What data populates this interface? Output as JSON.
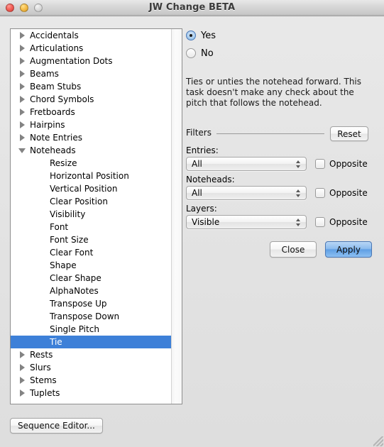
{
  "window": {
    "title": "JW Change BETA",
    "traffic_lights": [
      "close-button",
      "minimize-button",
      "zoom-button"
    ]
  },
  "tree": {
    "items": [
      {
        "label": "Accidentals",
        "level": 1,
        "state": "collapsed",
        "selected": false
      },
      {
        "label": "Articulations",
        "level": 1,
        "state": "collapsed",
        "selected": false
      },
      {
        "label": "Augmentation Dots",
        "level": 1,
        "state": "collapsed",
        "selected": false
      },
      {
        "label": "Beams",
        "level": 1,
        "state": "collapsed",
        "selected": false
      },
      {
        "label": "Beam Stubs",
        "level": 1,
        "state": "collapsed",
        "selected": false
      },
      {
        "label": "Chord Symbols",
        "level": 1,
        "state": "collapsed",
        "selected": false
      },
      {
        "label": "Fretboards",
        "level": 1,
        "state": "collapsed",
        "selected": false
      },
      {
        "label": "Hairpins",
        "level": 1,
        "state": "collapsed",
        "selected": false
      },
      {
        "label": "Note Entries",
        "level": 1,
        "state": "collapsed",
        "selected": false
      },
      {
        "label": "Noteheads",
        "level": 1,
        "state": "expanded",
        "selected": false
      },
      {
        "label": "Resize",
        "level": 2,
        "state": "leaf",
        "selected": false
      },
      {
        "label": "Horizontal Position",
        "level": 2,
        "state": "leaf",
        "selected": false
      },
      {
        "label": "Vertical Position",
        "level": 2,
        "state": "leaf",
        "selected": false
      },
      {
        "label": "Clear Position",
        "level": 2,
        "state": "leaf",
        "selected": false
      },
      {
        "label": "Visibility",
        "level": 2,
        "state": "leaf",
        "selected": false
      },
      {
        "label": "Font",
        "level": 2,
        "state": "leaf",
        "selected": false
      },
      {
        "label": "Font Size",
        "level": 2,
        "state": "leaf",
        "selected": false
      },
      {
        "label": "Clear Font",
        "level": 2,
        "state": "leaf",
        "selected": false
      },
      {
        "label": "Shape",
        "level": 2,
        "state": "leaf",
        "selected": false
      },
      {
        "label": "Clear Shape",
        "level": 2,
        "state": "leaf",
        "selected": false
      },
      {
        "label": "AlphaNotes",
        "level": 2,
        "state": "leaf",
        "selected": false
      },
      {
        "label": "Transpose Up",
        "level": 2,
        "state": "leaf",
        "selected": false
      },
      {
        "label": "Transpose Down",
        "level": 2,
        "state": "leaf",
        "selected": false
      },
      {
        "label": "Single Pitch",
        "level": 2,
        "state": "leaf",
        "selected": false
      },
      {
        "label": "Tie",
        "level": 2,
        "state": "leaf",
        "selected": true
      },
      {
        "label": "Rests",
        "level": 1,
        "state": "collapsed",
        "selected": false
      },
      {
        "label": "Slurs",
        "level": 1,
        "state": "collapsed",
        "selected": false
      },
      {
        "label": "Stems",
        "level": 1,
        "state": "collapsed",
        "selected": false
      },
      {
        "label": "Tuplets",
        "level": 1,
        "state": "collapsed",
        "selected": false
      }
    ],
    "selection_color": "#3d80d8"
  },
  "options": {
    "radios": [
      {
        "label": "Yes",
        "selected": true
      },
      {
        "label": "No",
        "selected": false
      }
    ],
    "description": "Ties or unties the notehead forward. This task doesn't make any check about the pitch that follows the notehead."
  },
  "filters": {
    "title": "Filters",
    "reset_label": "Reset",
    "groups": [
      {
        "label": "Entries:",
        "value": "All",
        "opposite_label": "Opposite",
        "opposite_checked": false
      },
      {
        "label": "Noteheads:",
        "value": "All",
        "opposite_label": "Opposite",
        "opposite_checked": false
      },
      {
        "label": "Layers:",
        "value": "Visible",
        "opposite_label": "Opposite",
        "opposite_checked": false
      }
    ]
  },
  "actions": {
    "close_label": "Close",
    "apply_label": "Apply",
    "apply_is_default": true,
    "sequence_editor_label": "Sequence Editor..."
  }
}
